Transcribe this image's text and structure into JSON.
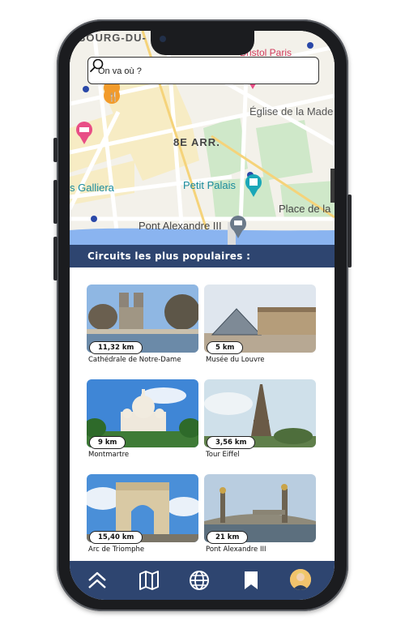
{
  "map": {
    "labels": {
      "faubourg": "BOURG-DU-",
      "bristol": "Bristol Paris",
      "eglise": "Église de la Made",
      "arrondissement": "8E ARR.",
      "galliera": "s Galliera",
      "petit_palais": "Petit Palais",
      "place": "Place de la",
      "pont": "Pont Alexandre III"
    }
  },
  "search": {
    "placeholder": "On va où ?"
  },
  "section": {
    "title": "Circuits les plus populaires :"
  },
  "tours": [
    {
      "title": "Cathédrale de Notre-Dame",
      "distance": "11,32 km"
    },
    {
      "title": "Musée du Louvre",
      "distance": "5 km"
    },
    {
      "title": "Montmartre",
      "distance": "9 km"
    },
    {
      "title": "Tour Eiffel",
      "distance": "3,56 km"
    },
    {
      "title": "Arc de Triomphe",
      "distance": "15,40 km"
    },
    {
      "title": "Pont Alexandre III",
      "distance": "21 km"
    }
  ],
  "nav": {
    "items": [
      "chevrons-up-icon",
      "map-icon",
      "globe-icon",
      "bookmark-icon",
      "avatar"
    ]
  },
  "colors": {
    "brand": "#2e4570",
    "accent": "#e83a5d"
  }
}
